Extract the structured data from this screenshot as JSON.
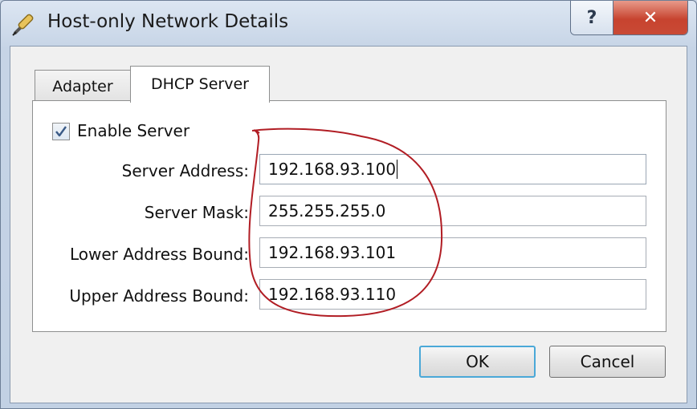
{
  "window": {
    "title": "Host-only Network Details",
    "help_glyph": "?",
    "close_glyph": "✕"
  },
  "tabs": [
    {
      "label": "Adapter",
      "selected": false
    },
    {
      "label": "DHCP Server",
      "selected": true
    }
  ],
  "dhcp": {
    "enable_label": "Enable Server",
    "enable_checked": true,
    "fields": [
      {
        "label": "Server Address:",
        "value": "192.168.93.100"
      },
      {
        "label": "Server Mask:",
        "value": "255.255.255.0"
      },
      {
        "label": "Lower Address Bound:",
        "value": "192.168.93.101"
      },
      {
        "label": "Upper Address Bound:",
        "value": "192.168.93.110"
      }
    ]
  },
  "buttons": {
    "ok": "OK",
    "cancel": "Cancel"
  },
  "colors": {
    "annotation": "#b11d24",
    "checkmark": "#3a5a86",
    "default_button_focus": "#4aa8d8"
  }
}
